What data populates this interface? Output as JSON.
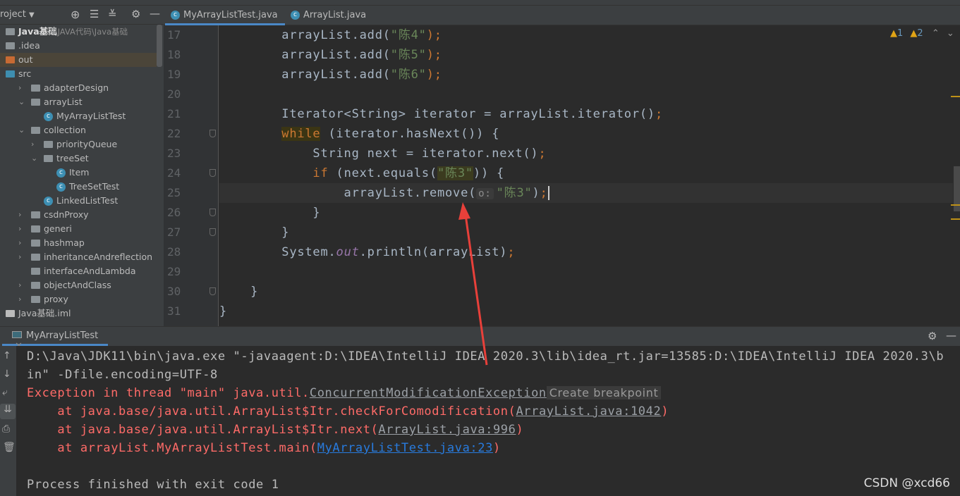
{
  "project_panel": {
    "title": "roject",
    "tree": [
      {
        "label": "Java基础",
        "path": "D:\\JAVA代码\\Java基础",
        "depth": 0,
        "type": "module",
        "open": true
      },
      {
        "label": ".idea",
        "depth": 1,
        "type": "folder-grey"
      },
      {
        "label": "out",
        "depth": 1,
        "type": "folder-orange",
        "selected": true
      },
      {
        "label": "src",
        "depth": 1,
        "type": "folder-blue",
        "open": true
      },
      {
        "label": "adapterDesign",
        "depth": 2,
        "type": "package",
        "chev": "closed"
      },
      {
        "label": "arrayList",
        "depth": 2,
        "type": "package",
        "chev": "open"
      },
      {
        "label": "MyArrayListTest",
        "depth": 3,
        "type": "class-run"
      },
      {
        "label": "collection",
        "depth": 2,
        "type": "package",
        "chev": "open"
      },
      {
        "label": "priorityQueue",
        "depth": 3,
        "type": "package",
        "chev": "closed"
      },
      {
        "label": "treeSet",
        "depth": 3,
        "type": "package",
        "chev": "open"
      },
      {
        "label": "Item",
        "depth": 4,
        "type": "class"
      },
      {
        "label": "TreeSetTest",
        "depth": 4,
        "type": "class-run"
      },
      {
        "label": "LinkedListTest",
        "depth": 3,
        "type": "class-run"
      },
      {
        "label": "csdnProxy",
        "depth": 2,
        "type": "package",
        "chev": "closed"
      },
      {
        "label": "generi",
        "depth": 2,
        "type": "package",
        "chev": "closed"
      },
      {
        "label": "hashmap",
        "depth": 2,
        "type": "package",
        "chev": "closed"
      },
      {
        "label": "inheritanceAndreflection",
        "depth": 2,
        "type": "package",
        "chev": "closed"
      },
      {
        "label": "interfaceAndLambda",
        "depth": 2,
        "type": "package"
      },
      {
        "label": "objectAndClass",
        "depth": 2,
        "type": "package",
        "chev": "closed"
      },
      {
        "label": "proxy",
        "depth": 2,
        "type": "package",
        "chev": "closed"
      },
      {
        "label": "Java基础.iml",
        "depth": 1,
        "type": "iml"
      }
    ]
  },
  "editor": {
    "tabs": [
      {
        "label": "MyArrayListTest.java",
        "active": true
      },
      {
        "label": "ArrayList.java",
        "active": false
      }
    ],
    "inspections": {
      "warnings": "1",
      "weak_warnings": "2"
    },
    "lines": [
      {
        "n": "17",
        "tokens": [
          [
            "        arrayList.add(",
            ""
          ],
          [
            "\"陈4\"",
            "st"
          ],
          [
            ");",
            "kw"
          ]
        ]
      },
      {
        "n": "18",
        "tokens": [
          [
            "        arrayList.add(",
            ""
          ],
          [
            "\"陈5\"",
            "st"
          ],
          [
            ");",
            "kw"
          ]
        ]
      },
      {
        "n": "19",
        "tokens": [
          [
            "        arrayList.add(",
            ""
          ],
          [
            "\"陈6\"",
            "st"
          ],
          [
            ");",
            "kw"
          ]
        ]
      },
      {
        "n": "20",
        "tokens": []
      },
      {
        "n": "21",
        "tokens": [
          [
            "        Iterator<String> iterator = arrayList.iterator()",
            ""
          ],
          [
            ";",
            "kw"
          ]
        ]
      },
      {
        "n": "22",
        "tokens": [
          [
            "        ",
            ""
          ],
          [
            "while",
            "kw kwhl"
          ],
          [
            " (iterator.hasNext()) {",
            ""
          ]
        ]
      },
      {
        "n": "23",
        "tokens": [
          [
            "            String next = iterator.next()",
            ""
          ],
          [
            ";",
            "kw"
          ]
        ]
      },
      {
        "n": "24",
        "tokens": [
          [
            "            ",
            ""
          ],
          [
            "if",
            "kw"
          ],
          [
            " (next.equals(",
            ""
          ],
          [
            "\"陈3\"",
            "st hl"
          ],
          [
            ")) {",
            ""
          ]
        ]
      },
      {
        "n": "25",
        "current": true,
        "tokens": [
          [
            "                arrayList.remove(",
            ""
          ],
          [
            "o:",
            "hint"
          ],
          [
            "\"陈3\"",
            "st"
          ],
          [
            ")",
            ""
          ],
          [
            ";",
            "kw caret"
          ]
        ]
      },
      {
        "n": "26",
        "tokens": [
          [
            "            }",
            ""
          ]
        ]
      },
      {
        "n": "27",
        "tokens": [
          [
            "        }",
            ""
          ]
        ]
      },
      {
        "n": "28",
        "tokens": [
          [
            "        System.",
            ""
          ],
          [
            "out",
            "fd"
          ],
          [
            ".println(arrayList)",
            ""
          ],
          [
            ";",
            "kw"
          ]
        ]
      },
      {
        "n": "29",
        "tokens": []
      },
      {
        "n": "30",
        "tokens": [
          [
            "    }",
            ""
          ]
        ]
      },
      {
        "n": "31",
        "tokens": [
          [
            "}",
            ""
          ]
        ]
      }
    ]
  },
  "run_panel": {
    "tab": "MyArrayListTest",
    "lines": [
      [
        [
          "D:\\Java\\JDK11\\bin\\java.exe \"-javaagent:D:\\IDEA\\IntelliJ IDEA 2020.3\\lib\\idea_rt.jar=13585:D:\\IDEA\\IntelliJ IDEA 2020.3\\bin\" -Dfile.encoding=UTF-8",
          ""
        ]
      ],
      [
        [
          "Exception in thread \"main\" java.util.",
          "err"
        ],
        [
          "ConcurrentModificationException",
          "glnk"
        ],
        [
          "Create breakpoint",
          "bp"
        ]
      ],
      [
        [
          "    at java.base/java.util.ArrayList$Itr.checkForComodification(",
          "err"
        ],
        [
          "ArrayList.java:1042",
          "glnk"
        ],
        [
          ")",
          "err"
        ]
      ],
      [
        [
          "    at java.base/java.util.ArrayList$Itr.next(",
          "err"
        ],
        [
          "ArrayList.java:996",
          "glnk"
        ],
        [
          ")",
          "err"
        ]
      ],
      [
        [
          "    at arrayList.MyArrayListTest.main(",
          "err"
        ],
        [
          "MyArrayListTest.java:23",
          "lnk"
        ],
        [
          ")",
          "err"
        ]
      ],
      [],
      [
        [
          "Process finished with exit code 1",
          ""
        ]
      ]
    ]
  },
  "watermark": "CSDN @xcd66",
  "colors": {
    "keyword": "#cc7832",
    "string": "#6a8759",
    "error": "#ff6b68",
    "link": "#287bde",
    "annotation_arrow": "#e8403a"
  }
}
